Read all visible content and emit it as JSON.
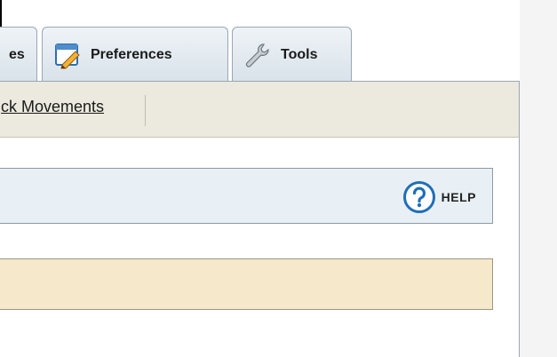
{
  "tabs": [
    {
      "label": "es",
      "icon": "unknown-icon"
    },
    {
      "label": "Preferences",
      "icon": "preferences-icon"
    },
    {
      "label": "Tools",
      "icon": "wrench-icon"
    }
  ],
  "toolbar": {
    "link_label": "ck Movements"
  },
  "help": {
    "label": "HELP",
    "icon": "help-icon"
  },
  "colors": {
    "tab_bg": "#d9e2ea",
    "toolbar_bg": "#ece9de",
    "help_bar_bg": "#e8f0f5",
    "notice_bg": "#f6e9cb",
    "help_icon": "#1f6fb8"
  }
}
